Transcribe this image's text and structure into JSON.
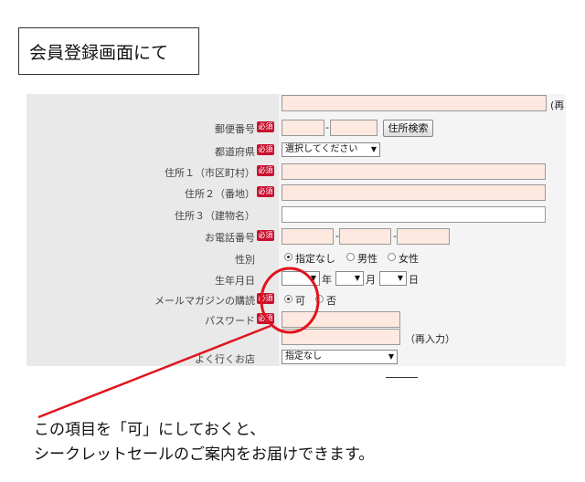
{
  "caption": "会員登録画面にて",
  "required_badge": "必須",
  "form": {
    "name_row_edge_text": "(再",
    "postal": {
      "label": "郵便番号",
      "separator": "-",
      "search_button": "住所検索"
    },
    "prefecture": {
      "label": "都道府県",
      "value": "選択してください"
    },
    "address1": {
      "label": "住所１（市区町村）"
    },
    "address2": {
      "label": "住所２（番地）"
    },
    "address3": {
      "label": "住所３（建物名）"
    },
    "phone": {
      "label": "お電話番号",
      "sep1": "-",
      "sep2": "-"
    },
    "gender": {
      "label": "性別",
      "options": [
        "指定なし",
        "男性",
        "女性"
      ],
      "selected": "指定なし"
    },
    "birthday": {
      "label": "生年月日",
      "year_unit": "年",
      "month_unit": "月",
      "day_unit": "日"
    },
    "newsletter": {
      "label": "メールマガジンの購読",
      "options": [
        "可",
        "否"
      ],
      "selected": "可"
    },
    "password": {
      "label": "パスワード",
      "reenter_note": "（再入力）"
    },
    "store": {
      "label": "よく行くお店",
      "value": "指定なし"
    }
  },
  "note": {
    "line1": "この項目を「可」にしておくと、",
    "line2": "シークレットセールのご案内をお届けできます。"
  },
  "colors": {
    "required": "#c8102e",
    "annotation": "#e0141e",
    "input_fill": "#fde9e0"
  }
}
